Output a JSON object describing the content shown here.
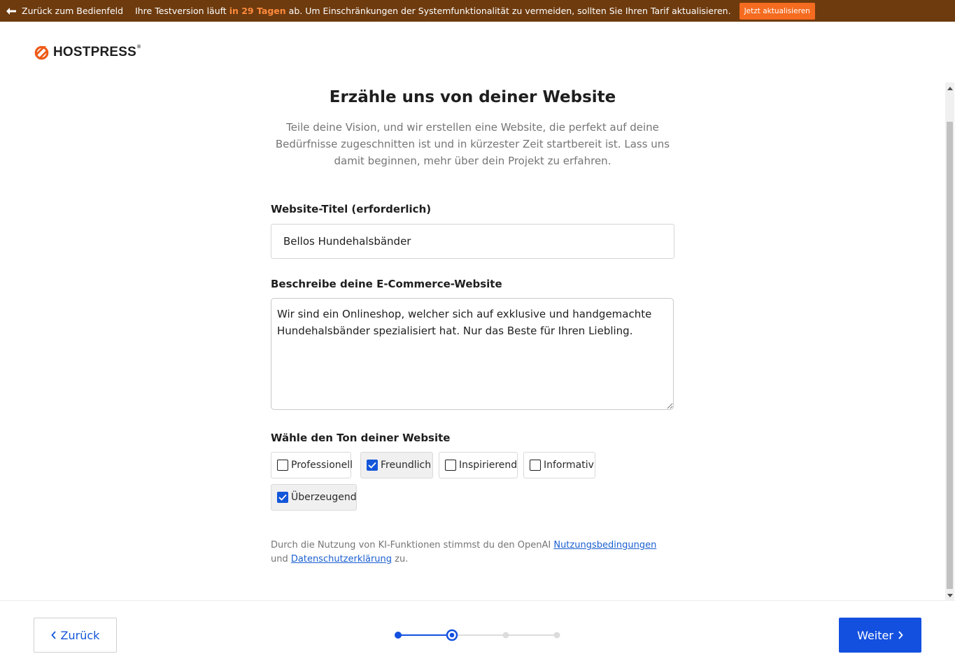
{
  "topbar": {
    "back_label": "Zurück zum Bedienfeld",
    "trial_prefix": "Ihre Testversion läuft",
    "trial_days": "in 29 Tagen",
    "trial_suffix": "ab. Um Einschränkungen der Systemfunktionalität zu vermeiden, sollten Sie Ihren Tarif aktualisieren.",
    "upgrade_label": "Jetzt aktualisieren",
    "background_color": "#6e3b0e",
    "accent_color": "#f56b1f"
  },
  "logo": {
    "text": "HOSTPRESS",
    "reg": "®",
    "icon": "hostpress-logo-icon"
  },
  "main": {
    "title": "Erzähle uns von deiner Website",
    "subtitle": "Teile deine Vision, und wir erstellen eine Website, die perfekt auf deine Bedürfnisse zugeschnitten ist und in kürzester Zeit startbereit ist. Lass uns damit beginnen, mehr über dein Projekt zu erfahren.",
    "title_field": {
      "label": "Website-Titel (erforderlich)",
      "value": "Bellos Hundehalsbänder"
    },
    "description_field": {
      "label": "Beschreibe deine E-Commerce-Website",
      "value": "Wir sind ein Onlineshop, welcher sich auf exklusive und handgemachte Hundehalsbänder spezialisiert hat. Nur das Beste für Ihren Liebling."
    },
    "tone": {
      "label": "Wähle den Ton deiner Website",
      "options": [
        {
          "label": "Professionell",
          "checked": false
        },
        {
          "label": "Freundlich",
          "checked": true
        },
        {
          "label": "Inspirierend",
          "checked": false
        },
        {
          "label": "Informativ",
          "checked": false
        },
        {
          "label": "Überzeugend",
          "checked": true
        }
      ]
    },
    "legal": {
      "prefix": "Durch die Nutzung von KI-Funktionen stimmst du den OpenAI",
      "terms_link": "Nutzungsbedingungen",
      "middle": "und",
      "privacy_link": "Datenschutzerklärung",
      "suffix": "zu."
    }
  },
  "footer": {
    "back_label": "Zurück",
    "next_label": "Weiter",
    "steps_total": 4,
    "current_step": 2,
    "primary_color": "#1350e0"
  }
}
